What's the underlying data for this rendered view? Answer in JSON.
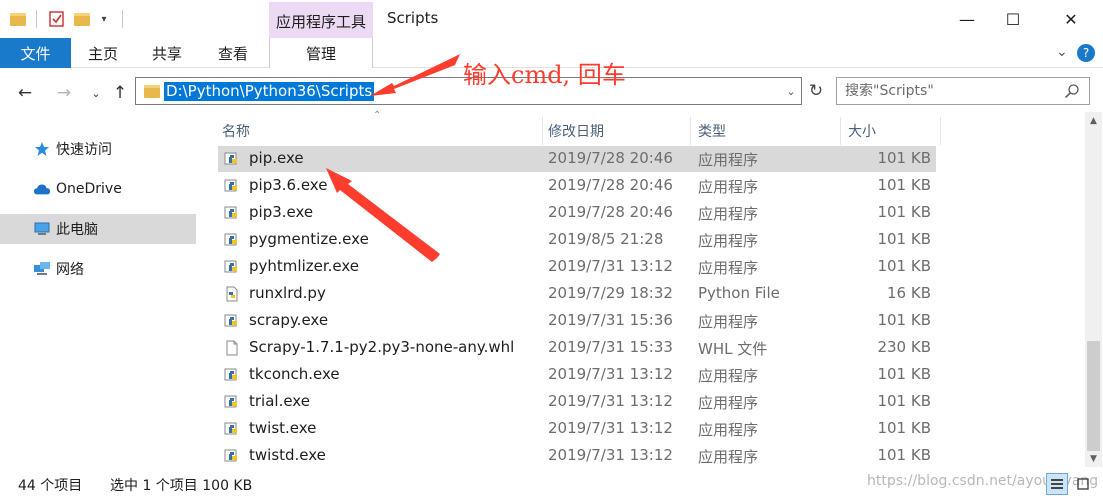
{
  "window": {
    "title": "Scripts",
    "context_tab": "应用程序工具",
    "minimize": "—",
    "maximize": "☐",
    "close": "✕"
  },
  "ribbon": {
    "tabs": [
      "文件",
      "主页",
      "共享",
      "查看",
      "管理"
    ]
  },
  "address": {
    "path": "D:\\Python\\Python36\\Scripts",
    "search_placeholder": "搜索\"Scripts\""
  },
  "annotation": "输入cmd, 回车",
  "nav": {
    "items": [
      {
        "label": "快速访问",
        "icon": "star-icon"
      },
      {
        "label": "OneDrive",
        "icon": "cloud-icon"
      },
      {
        "label": "此电脑",
        "icon": "computer-icon"
      },
      {
        "label": "网络",
        "icon": "network-icon"
      }
    ]
  },
  "columns": [
    "名称",
    "修改日期",
    "类型",
    "大小"
  ],
  "files": [
    {
      "name": "pip.exe",
      "date": "2019/7/28 20:46",
      "type": "应用程序",
      "size": "101 KB",
      "icon": "python-exe-icon",
      "selected": true
    },
    {
      "name": "pip3.6.exe",
      "date": "2019/7/28 20:46",
      "type": "应用程序",
      "size": "101 KB",
      "icon": "python-exe-icon"
    },
    {
      "name": "pip3.exe",
      "date": "2019/7/28 20:46",
      "type": "应用程序",
      "size": "101 KB",
      "icon": "python-exe-icon"
    },
    {
      "name": "pygmentize.exe",
      "date": "2019/8/5 21:28",
      "type": "应用程序",
      "size": "101 KB",
      "icon": "python-exe-icon"
    },
    {
      "name": "pyhtmlizer.exe",
      "date": "2019/7/31 13:12",
      "type": "应用程序",
      "size": "101 KB",
      "icon": "python-exe-icon"
    },
    {
      "name": "runxlrd.py",
      "date": "2019/7/29 18:32",
      "type": "Python File",
      "size": "16 KB",
      "icon": "python-file-icon"
    },
    {
      "name": "scrapy.exe",
      "date": "2019/7/31 15:36",
      "type": "应用程序",
      "size": "101 KB",
      "icon": "python-exe-icon"
    },
    {
      "name": "Scrapy-1.7.1-py2.py3-none-any.whl",
      "date": "2019/7/31 15:33",
      "type": "WHL 文件",
      "size": "230 KB",
      "icon": "blank-file-icon"
    },
    {
      "name": "tkconch.exe",
      "date": "2019/7/31 13:12",
      "type": "应用程序",
      "size": "101 KB",
      "icon": "python-exe-icon"
    },
    {
      "name": "trial.exe",
      "date": "2019/7/31 13:12",
      "type": "应用程序",
      "size": "101 KB",
      "icon": "python-exe-icon"
    },
    {
      "name": "twist.exe",
      "date": "2019/7/31 13:12",
      "type": "应用程序",
      "size": "101 KB",
      "icon": "python-exe-icon"
    },
    {
      "name": "twistd.exe",
      "date": "2019/7/31 13:12",
      "type": "应用程序",
      "size": "101 KB",
      "icon": "python-exe-icon"
    }
  ],
  "status": {
    "count": "44 个项目",
    "selection": "选中 1 个项目 100 KB"
  },
  "watermark": "https://blog.csdn.net/ayouleyang",
  "colors": {
    "file_tab": "#1979ca",
    "context_tab": "#ecdaf5",
    "address_selection": "#0078d7",
    "annotation": "#ff3d2e",
    "selected_row": "#d9d9d9"
  }
}
